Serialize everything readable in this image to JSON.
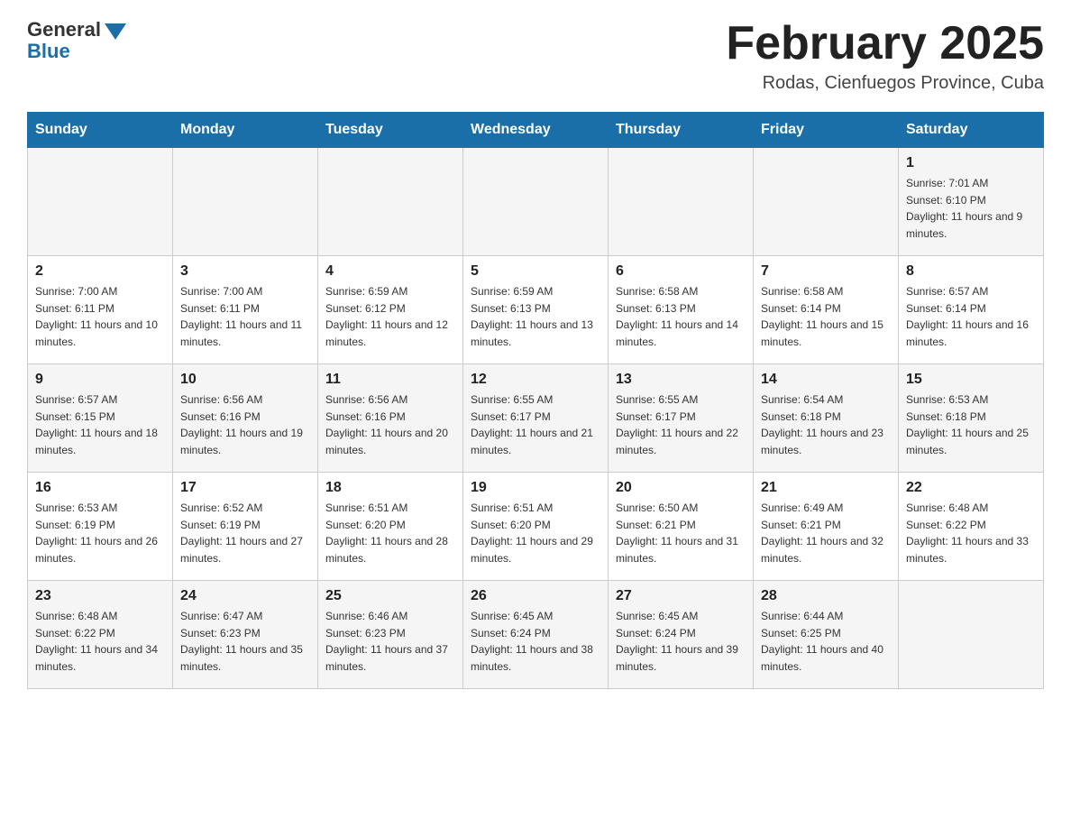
{
  "header": {
    "logo_general": "General",
    "logo_blue": "Blue",
    "month_title": "February 2025",
    "location": "Rodas, Cienfuegos Province, Cuba"
  },
  "days_of_week": [
    "Sunday",
    "Monday",
    "Tuesday",
    "Wednesday",
    "Thursday",
    "Friday",
    "Saturday"
  ],
  "weeks": [
    [
      {
        "day": "",
        "info": ""
      },
      {
        "day": "",
        "info": ""
      },
      {
        "day": "",
        "info": ""
      },
      {
        "day": "",
        "info": ""
      },
      {
        "day": "",
        "info": ""
      },
      {
        "day": "",
        "info": ""
      },
      {
        "day": "1",
        "info": "Sunrise: 7:01 AM\nSunset: 6:10 PM\nDaylight: 11 hours and 9 minutes."
      }
    ],
    [
      {
        "day": "2",
        "info": "Sunrise: 7:00 AM\nSunset: 6:11 PM\nDaylight: 11 hours and 10 minutes."
      },
      {
        "day": "3",
        "info": "Sunrise: 7:00 AM\nSunset: 6:11 PM\nDaylight: 11 hours and 11 minutes."
      },
      {
        "day": "4",
        "info": "Sunrise: 6:59 AM\nSunset: 6:12 PM\nDaylight: 11 hours and 12 minutes."
      },
      {
        "day": "5",
        "info": "Sunrise: 6:59 AM\nSunset: 6:13 PM\nDaylight: 11 hours and 13 minutes."
      },
      {
        "day": "6",
        "info": "Sunrise: 6:58 AM\nSunset: 6:13 PM\nDaylight: 11 hours and 14 minutes."
      },
      {
        "day": "7",
        "info": "Sunrise: 6:58 AM\nSunset: 6:14 PM\nDaylight: 11 hours and 15 minutes."
      },
      {
        "day": "8",
        "info": "Sunrise: 6:57 AM\nSunset: 6:14 PM\nDaylight: 11 hours and 16 minutes."
      }
    ],
    [
      {
        "day": "9",
        "info": "Sunrise: 6:57 AM\nSunset: 6:15 PM\nDaylight: 11 hours and 18 minutes."
      },
      {
        "day": "10",
        "info": "Sunrise: 6:56 AM\nSunset: 6:16 PM\nDaylight: 11 hours and 19 minutes."
      },
      {
        "day": "11",
        "info": "Sunrise: 6:56 AM\nSunset: 6:16 PM\nDaylight: 11 hours and 20 minutes."
      },
      {
        "day": "12",
        "info": "Sunrise: 6:55 AM\nSunset: 6:17 PM\nDaylight: 11 hours and 21 minutes."
      },
      {
        "day": "13",
        "info": "Sunrise: 6:55 AM\nSunset: 6:17 PM\nDaylight: 11 hours and 22 minutes."
      },
      {
        "day": "14",
        "info": "Sunrise: 6:54 AM\nSunset: 6:18 PM\nDaylight: 11 hours and 23 minutes."
      },
      {
        "day": "15",
        "info": "Sunrise: 6:53 AM\nSunset: 6:18 PM\nDaylight: 11 hours and 25 minutes."
      }
    ],
    [
      {
        "day": "16",
        "info": "Sunrise: 6:53 AM\nSunset: 6:19 PM\nDaylight: 11 hours and 26 minutes."
      },
      {
        "day": "17",
        "info": "Sunrise: 6:52 AM\nSunset: 6:19 PM\nDaylight: 11 hours and 27 minutes."
      },
      {
        "day": "18",
        "info": "Sunrise: 6:51 AM\nSunset: 6:20 PM\nDaylight: 11 hours and 28 minutes."
      },
      {
        "day": "19",
        "info": "Sunrise: 6:51 AM\nSunset: 6:20 PM\nDaylight: 11 hours and 29 minutes."
      },
      {
        "day": "20",
        "info": "Sunrise: 6:50 AM\nSunset: 6:21 PM\nDaylight: 11 hours and 31 minutes."
      },
      {
        "day": "21",
        "info": "Sunrise: 6:49 AM\nSunset: 6:21 PM\nDaylight: 11 hours and 32 minutes."
      },
      {
        "day": "22",
        "info": "Sunrise: 6:48 AM\nSunset: 6:22 PM\nDaylight: 11 hours and 33 minutes."
      }
    ],
    [
      {
        "day": "23",
        "info": "Sunrise: 6:48 AM\nSunset: 6:22 PM\nDaylight: 11 hours and 34 minutes."
      },
      {
        "day": "24",
        "info": "Sunrise: 6:47 AM\nSunset: 6:23 PM\nDaylight: 11 hours and 35 minutes."
      },
      {
        "day": "25",
        "info": "Sunrise: 6:46 AM\nSunset: 6:23 PM\nDaylight: 11 hours and 37 minutes."
      },
      {
        "day": "26",
        "info": "Sunrise: 6:45 AM\nSunset: 6:24 PM\nDaylight: 11 hours and 38 minutes."
      },
      {
        "day": "27",
        "info": "Sunrise: 6:45 AM\nSunset: 6:24 PM\nDaylight: 11 hours and 39 minutes."
      },
      {
        "day": "28",
        "info": "Sunrise: 6:44 AM\nSunset: 6:25 PM\nDaylight: 11 hours and 40 minutes."
      },
      {
        "day": "",
        "info": ""
      }
    ]
  ]
}
